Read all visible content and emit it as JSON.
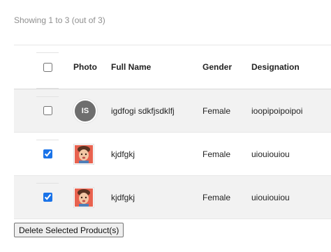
{
  "summary": "Showing 1 to 3 (out of 3)",
  "table": {
    "headers": {
      "photo": "Photo",
      "full_name": "Full Name",
      "gender": "Gender",
      "designation": "Designation"
    },
    "select_all_checked": false,
    "rows": [
      {
        "checked": false,
        "avatar_type": "initials",
        "initials": "IS",
        "full_name": "igdfogi sdkfjsdklfj",
        "gender": "Female",
        "designation": "ioopipoipoipoi"
      },
      {
        "checked": true,
        "avatar_type": "photo",
        "full_name": "kjdfgkj",
        "gender": "Female",
        "designation": "uiouiouiou"
      },
      {
        "checked": true,
        "avatar_type": "photo",
        "full_name": "kjdfgkj",
        "gender": "Female",
        "designation": "uiouiouiou"
      }
    ]
  },
  "delete_button_label": "Delete Selected Product(s)",
  "colors": {
    "row_shade": "#f2f2f2",
    "checkbox_accent": "#1a73e8",
    "avatar_bg": "#6e6e6e",
    "summary_text": "#8f8f8f"
  }
}
